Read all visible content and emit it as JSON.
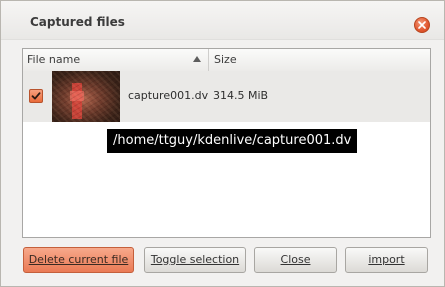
{
  "window": {
    "title": "Captured files",
    "close_icon": "close-icon",
    "accent_color": "#e2572f"
  },
  "table": {
    "columns": [
      "File name",
      "Size"
    ],
    "sort_indicator": "sort-ascending-icon",
    "rows": [
      {
        "checked": true,
        "thumbnail": "video-thumbnail",
        "file_name": "capture001.dv",
        "size": "314.5 MiB"
      }
    ]
  },
  "tooltip": {
    "text": "/home/ttguy/kdenlive/capture001.dv"
  },
  "buttons": {
    "delete_label": "Delete current file",
    "toggle_label": "Toggle selection",
    "close_label": "Close",
    "import_label": "import"
  }
}
